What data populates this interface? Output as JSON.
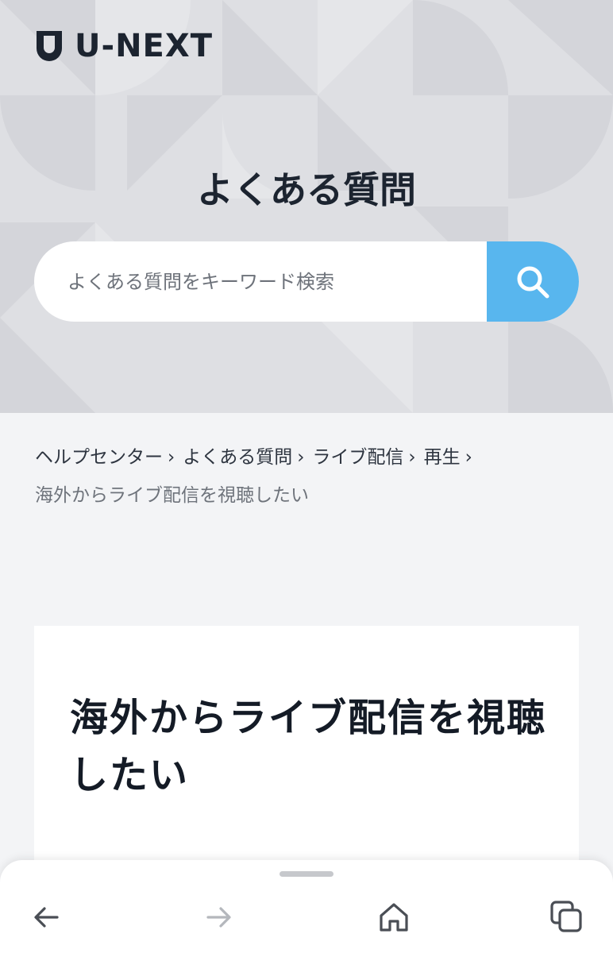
{
  "brand": {
    "name": "U-NEXT"
  },
  "hero": {
    "title": "よくある質問",
    "search_placeholder": "よくある質問をキーワード検索"
  },
  "breadcrumb": {
    "items": [
      "ヘルプセンター",
      "よくある質問",
      "ライブ配信",
      "再生"
    ],
    "separator": "›",
    "current": "海外からライブ配信を視聴したい"
  },
  "article": {
    "title": "海外からライブ配信を視聴したい"
  },
  "browser_nav": {
    "back": "back-arrow-icon",
    "forward": "forward-arrow-icon",
    "home": "home-icon",
    "tabs": "tabs-icon"
  },
  "colors": {
    "accent": "#58b6ee",
    "hero_bg": "#dedfe3",
    "page_bg": "#f3f4f6",
    "text": "#1c2430"
  }
}
